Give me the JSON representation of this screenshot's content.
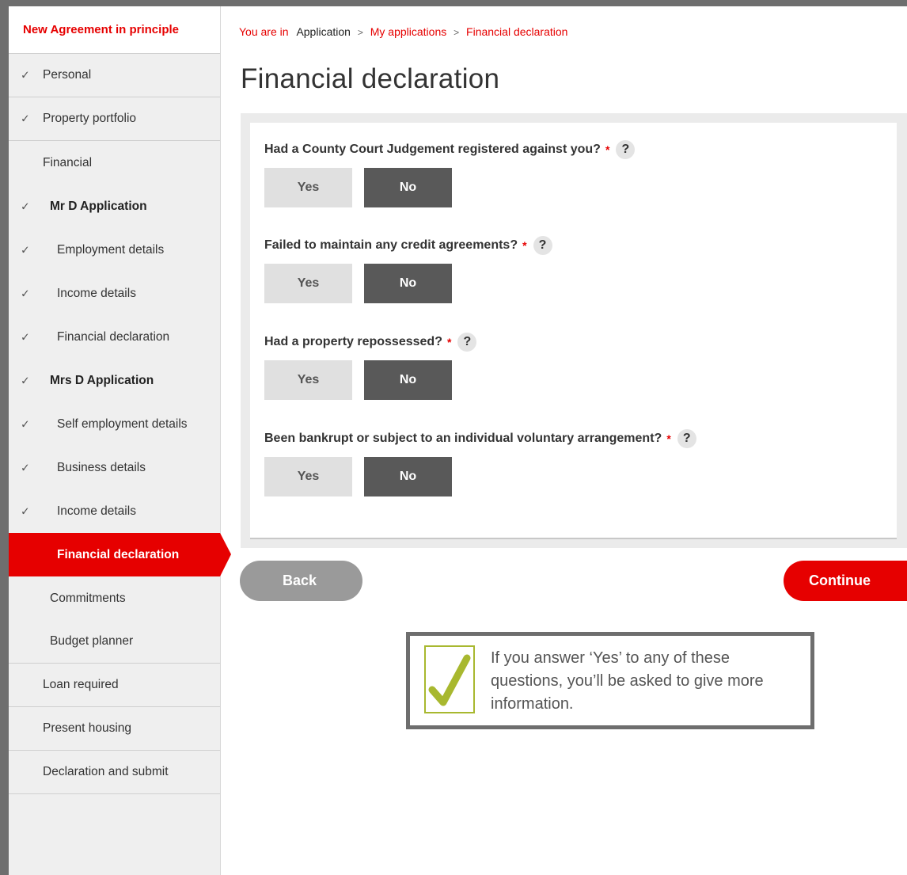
{
  "sidebar": {
    "title": "New Agreement in principle",
    "items": [
      {
        "label": "Personal"
      },
      {
        "label": "Property portfolio"
      },
      {
        "label": "Financial"
      },
      {
        "label": "Mr D Application"
      },
      {
        "label": "Employment details"
      },
      {
        "label": "Income details"
      },
      {
        "label": "Financial declaration"
      },
      {
        "label": "Mrs D Application"
      },
      {
        "label": "Self employment details"
      },
      {
        "label": "Business details"
      },
      {
        "label": "Income details"
      },
      {
        "label": "Financial declaration"
      },
      {
        "label": "Commitments"
      },
      {
        "label": "Budget planner"
      },
      {
        "label": "Loan required"
      },
      {
        "label": "Present housing"
      },
      {
        "label": "Declaration and submit"
      }
    ],
    "check_icon": "✓"
  },
  "breadcrumb": {
    "prefix": "You are in",
    "items": [
      "Application",
      "My applications",
      "Financial declaration"
    ],
    "separator": ">"
  },
  "page": {
    "title": "Financial declaration"
  },
  "questions": [
    {
      "text": "Had a County Court Judgement registered against you?",
      "selected": "No"
    },
    {
      "text": "Failed to maintain any credit agreements?",
      "selected": "No"
    },
    {
      "text": "Had a property repossessed?",
      "selected": "No"
    },
    {
      "text": "Been bankrupt or subject to an individual voluntary arrangement?",
      "selected": "No"
    }
  ],
  "labels": {
    "required_mark": "*",
    "help": "?",
    "yes": "Yes",
    "no": "No"
  },
  "actions": {
    "back": "Back",
    "continue": "Continue"
  },
  "callout": {
    "text": "If you answer ‘Yes’ to any of these questions, you’ll be asked to give more information."
  },
  "colors": {
    "brand_red": "#e60000",
    "selected_button": "#595959",
    "unselected_button": "#e0e0e0",
    "tick_green": "#a8b82f"
  }
}
